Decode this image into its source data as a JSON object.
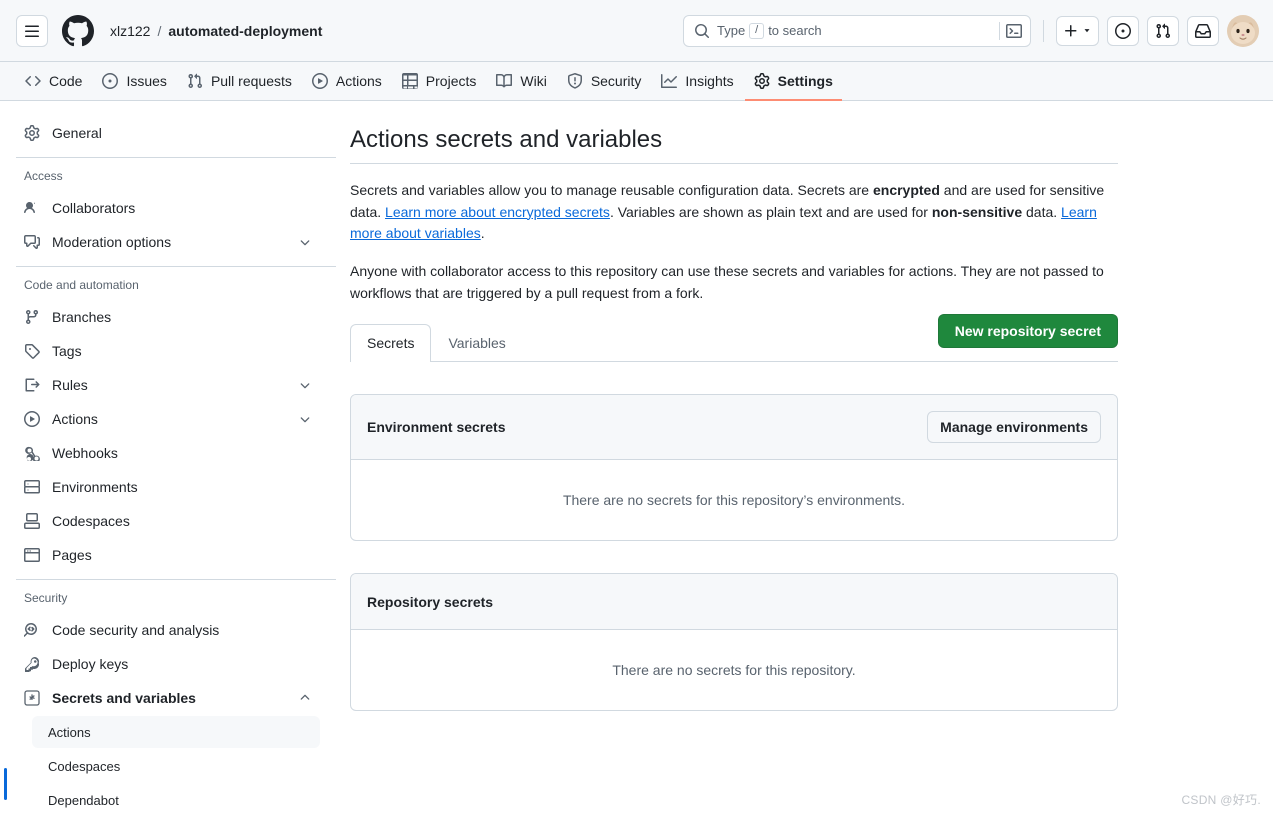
{
  "header": {
    "menu_icon": "hamburger-icon",
    "logo_icon": "github-logo-icon",
    "owner": "xlz122",
    "separator": "/",
    "repo": "automated-deployment",
    "search": {
      "icon": "search-icon",
      "placeholder_prefix": "Type",
      "slash_key": "/",
      "placeholder_suffix": "to search",
      "command_icon": "terminal-icon"
    },
    "actions": [
      {
        "name": "create-new-button",
        "icon": "plus-icon",
        "has_caret": true
      },
      {
        "name": "issues-button",
        "icon": "issue-opened-icon"
      },
      {
        "name": "pull-requests-button",
        "icon": "git-pull-request-icon"
      },
      {
        "name": "notifications-button",
        "icon": "inbox-icon"
      }
    ],
    "avatar_alt": "user-avatar"
  },
  "repo_nav": {
    "items": [
      {
        "label": "Code",
        "icon": "code-icon",
        "active": false
      },
      {
        "label": "Issues",
        "icon": "issue-opened-icon",
        "active": false
      },
      {
        "label": "Pull requests",
        "icon": "git-pull-request-icon",
        "active": false
      },
      {
        "label": "Actions",
        "icon": "play-icon",
        "active": false
      },
      {
        "label": "Projects",
        "icon": "table-icon",
        "active": false
      },
      {
        "label": "Wiki",
        "icon": "book-icon",
        "active": false
      },
      {
        "label": "Security",
        "icon": "shield-icon",
        "active": false
      },
      {
        "label": "Insights",
        "icon": "graph-icon",
        "active": false
      },
      {
        "label": "Settings",
        "icon": "gear-icon",
        "active": true
      }
    ]
  },
  "sidebar": {
    "general": {
      "label": "General",
      "icon": "gear-icon"
    },
    "sections": [
      {
        "heading": "Access",
        "items": [
          {
            "label": "Collaborators",
            "icon": "people-icon",
            "expandable": false
          },
          {
            "label": "Moderation options",
            "icon": "comment-discussion-icon",
            "expandable": true,
            "expanded": false
          }
        ]
      },
      {
        "heading": "Code and automation",
        "items": [
          {
            "label": "Branches",
            "icon": "git-branch-icon",
            "expandable": false
          },
          {
            "label": "Tags",
            "icon": "tag-icon",
            "expandable": false
          },
          {
            "label": "Rules",
            "icon": "rules-icon",
            "expandable": true,
            "expanded": false
          },
          {
            "label": "Actions",
            "icon": "play-icon",
            "expandable": true,
            "expanded": false
          },
          {
            "label": "Webhooks",
            "icon": "webhook-icon",
            "expandable": false
          },
          {
            "label": "Environments",
            "icon": "server-icon",
            "expandable": false
          },
          {
            "label": "Codespaces",
            "icon": "codespaces-icon",
            "expandable": false
          },
          {
            "label": "Pages",
            "icon": "browser-icon",
            "expandable": false
          }
        ]
      },
      {
        "heading": "Security",
        "items": [
          {
            "label": "Code security and analysis",
            "icon": "codescan-icon",
            "expandable": false
          },
          {
            "label": "Deploy keys",
            "icon": "key-icon",
            "expandable": false
          },
          {
            "label": "Secrets and variables",
            "icon": "asterisk-box-icon",
            "expandable": true,
            "expanded": true,
            "bold": true
          }
        ],
        "subitems": [
          {
            "label": "Actions",
            "selected": true
          },
          {
            "label": "Codespaces",
            "selected": false
          },
          {
            "label": "Dependabot",
            "selected": false
          }
        ]
      }
    ]
  },
  "main": {
    "title": "Actions secrets and variables",
    "paragraph1": {
      "part1": "Secrets and variables allow you to manage reusable configuration data. Secrets are ",
      "bold1": "encrypted",
      "part2": " and are used for sensitive data. ",
      "link1": "Learn more about encrypted secrets",
      "part3": ". Variables are shown as plain text and are used for ",
      "bold2": "non-sensitive",
      "part4": " data. ",
      "link2": "Learn more about variables",
      "part5": "."
    },
    "paragraph2": "Anyone with collaborator access to this repository can use these secrets and variables for actions. They are not passed to workflows that are triggered by a pull request from a fork.",
    "tabs": [
      {
        "label": "Secrets",
        "active": true
      },
      {
        "label": "Variables",
        "active": false
      }
    ],
    "new_secret_button": "New repository secret",
    "panels": [
      {
        "title": "Environment secrets",
        "action_button": "Manage environments",
        "empty_text": "There are no secrets for this repository’s environments."
      },
      {
        "title": "Repository secrets",
        "action_button": null,
        "empty_text": "There are no secrets for this repository."
      }
    ]
  },
  "watermark": "CSDN @好巧.",
  "colors": {
    "accent": "#0969da",
    "success": "#1f883d",
    "active_tab_underline": "#fd8c73",
    "border": "#d1d9e0",
    "canvas_subtle": "#f6f8fa",
    "fg_muted": "#59636e"
  }
}
